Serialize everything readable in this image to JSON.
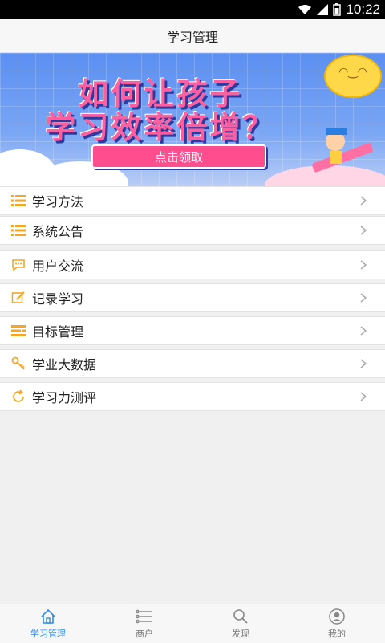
{
  "status_bar": {
    "time": "10:22"
  },
  "header": {
    "title": "学习管理"
  },
  "banner": {
    "headline_line1": "如何让孩子",
    "headline_line2": "学习效率倍增？",
    "cta_label": "点击领取",
    "slide_count": 3,
    "active_slide": 2
  },
  "menu": {
    "items": [
      {
        "label": "学习方法",
        "icon": "list-icon"
      },
      {
        "label": "系统公告",
        "icon": "list-icon"
      },
      {
        "label": "用户交流",
        "icon": "chat-icon"
      },
      {
        "label": "记录学习",
        "icon": "edit-icon"
      },
      {
        "label": "目标管理",
        "icon": "target-list-icon"
      },
      {
        "label": "学业大数据",
        "icon": "key-icon"
      },
      {
        "label": "学习力测评",
        "icon": "refresh-icon"
      }
    ]
  },
  "tab_bar": {
    "tabs": [
      {
        "label": "学习管理",
        "icon": "home-icon",
        "active": true
      },
      {
        "label": "商户",
        "icon": "list-icon",
        "active": false
      },
      {
        "label": "发现",
        "icon": "search-icon",
        "active": false
      },
      {
        "label": "我的",
        "icon": "user-icon",
        "active": false
      }
    ]
  },
  "colors": {
    "accent": "#2f8be8",
    "icon_orange": "#f5a623"
  }
}
